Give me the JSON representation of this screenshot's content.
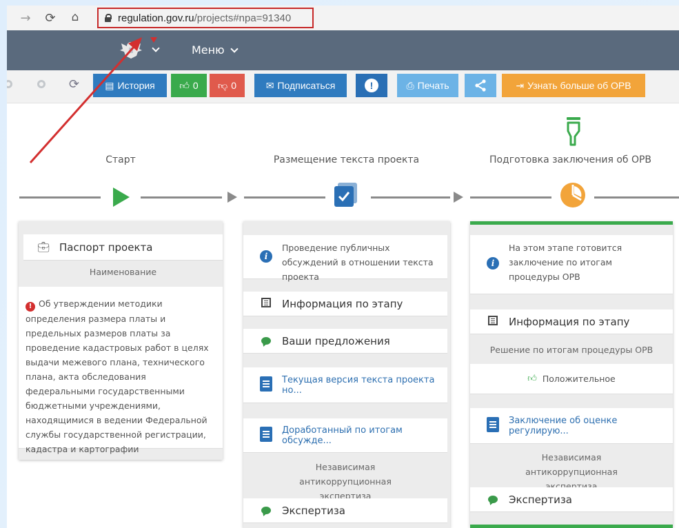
{
  "browser": {
    "url_host": "regulation.gov.ru",
    "url_path": "/projects#npa=91340"
  },
  "header": {
    "menu_label": "Меню"
  },
  "toolbar": {
    "history_label": "История",
    "like_count": "0",
    "dislike_count": "0",
    "subscribe_label": "Подписаться",
    "print_label": "Печать",
    "learn_more_label": "Узнать больше об ОРВ",
    "colors": {
      "history": "#2f7bbf",
      "like": "#3aaa4c",
      "dislike": "#e05a4c",
      "subscribe": "#2f7bbf",
      "alert": "#2a6fb5",
      "print": "#6cb3e6",
      "share": "#6cb3e6",
      "learn": "#f2a43a"
    }
  },
  "timeline": {
    "stage1_title": "Старт",
    "stage2_title": "Размещение текста проекта",
    "stage3_title": "Подготовка заключения об ОРВ"
  },
  "card1": {
    "passport_label": "Паспорт проекта",
    "name_caption": "Наименование",
    "description": "Об утверждении методики определения размера платы и предельных размеров платы за проведение кадастровых работ в целях выдачи межевого плана, технического плана, акта обследования федеральными государственными бюджетными учреждениями, находящимися в ведении Федеральной службы государственной регистрации, кадастра и картографии"
  },
  "card2": {
    "info_text": "Проведение публичных обсуждений в отношении текста проекта",
    "stage_info_label": "Информация по этапу",
    "proposals_label": "Ваши предложения",
    "doc1_label": "Текущая версия текста проекта но...",
    "doc2_label": "Доработанный по итогам обсужде...",
    "anticorruption_caption": "Независимая антикоррупционная экспертиза",
    "expertise_label": "Экспертиза"
  },
  "card3": {
    "info_text": "На этом этапе готовится заключение по итогам процедуры ОРВ",
    "stage_info_label": "Информация по этапу",
    "decision_caption": "Решение по итогам процедуры ОРВ",
    "positive_label": "Положительное",
    "doc_label": "Заключение об оценке регулирую...",
    "anticorruption_caption": "Независимая антикоррупционная экспертиза",
    "expertise_label": "Экспертиза"
  }
}
